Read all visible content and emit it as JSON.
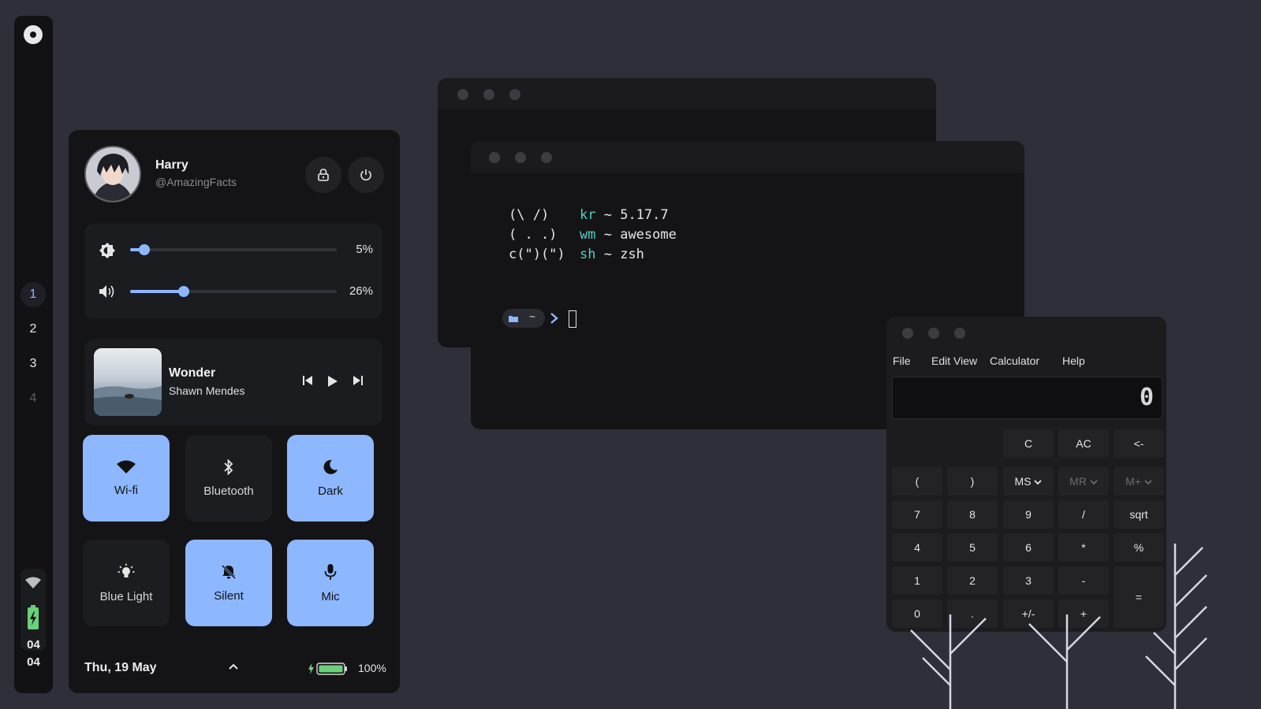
{
  "sidebar": {
    "workspaces": [
      "1",
      "2",
      "3",
      "4"
    ],
    "active_workspace": "1",
    "clock_hour": "04",
    "clock_minute": "04",
    "icons": [
      "app-logo-icon",
      "wifi-icon",
      "battery-charging-icon"
    ]
  },
  "control_center": {
    "user": {
      "name": "Harry",
      "handle": "@AmazingFacts"
    },
    "brightness": {
      "value": 0.05,
      "label": "5%"
    },
    "volume": {
      "value": 0.26,
      "label": "26%"
    },
    "media": {
      "title": "Wonder",
      "artist": "Shawn Mendes"
    },
    "tiles": [
      {
        "label": "Wi-fi",
        "on": true,
        "icon": "wifi-icon"
      },
      {
        "label": "Bluetooth",
        "on": false,
        "icon": "bluetooth-icon"
      },
      {
        "label": "Dark",
        "on": true,
        "icon": "moon-icon"
      },
      {
        "label": "Blue Light",
        "on": false,
        "icon": "lightbulb-icon"
      },
      {
        "label": "Silent",
        "on": true,
        "icon": "bell-off-icon"
      },
      {
        "label": "Mic",
        "on": true,
        "icon": "mic-icon"
      }
    ],
    "date": "Thu, 19 May",
    "battery": {
      "value": 1.0,
      "label": "100%"
    },
    "colors": {
      "accent": "#8db7ff",
      "panel": "#141416",
      "battery": "#6ad07a"
    }
  },
  "terminal": {
    "art": [
      "(\\ /)",
      "( . .)",
      "c(\")(\")"
    ],
    "info": [
      {
        "key": "kr",
        "value": "~ 5.17.7"
      },
      {
        "key": "wm",
        "value": "~ awesome"
      },
      {
        "key": "sh",
        "value": "~ zsh"
      }
    ],
    "prompt_dir": "~",
    "colors": {
      "key": "#4fd1c5",
      "prompt": "#8db7ff"
    }
  },
  "calculator": {
    "menu": [
      "File",
      "Edit",
      "View",
      "Calculator",
      "Help"
    ],
    "display": "0",
    "buttons": {
      "row0": [
        "C",
        "AC",
        "<-"
      ],
      "row1": [
        "(",
        ")",
        "MS",
        "MR",
        "M+"
      ],
      "row2": [
        "7",
        "8",
        "9",
        "/",
        "sqrt"
      ],
      "row3": [
        "4",
        "5",
        "6",
        "*",
        "%"
      ],
      "row4": [
        "1",
        "2",
        "3",
        "-",
        "="
      ],
      "row5": [
        "0",
        ".",
        "+/-",
        "+"
      ]
    }
  }
}
